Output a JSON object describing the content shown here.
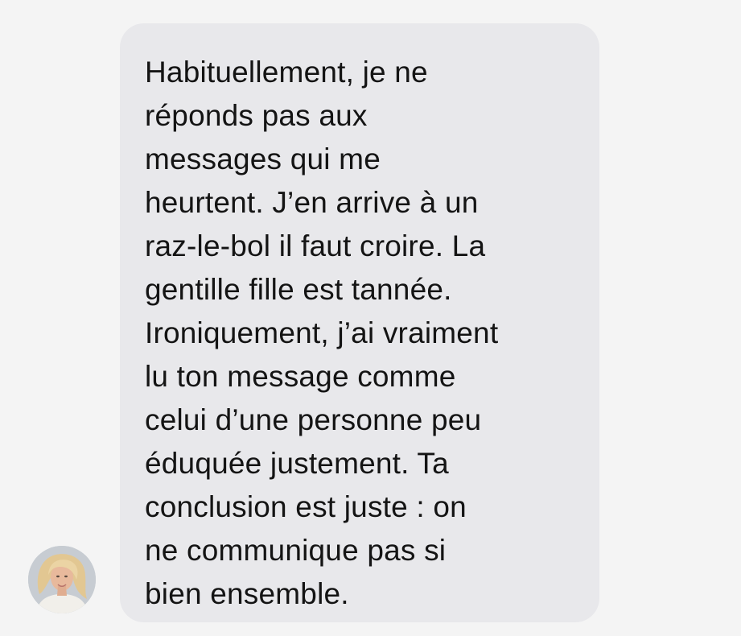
{
  "message": {
    "lines": [
      "Habituellement, je ne",
      "réponds pas aux",
      "messages qui me",
      "heurtent. J’en arrive à un",
      "raz-le-bol il faut croire. La",
      "gentille fille est tannée.",
      "Ironiquement, j’ai vraiment",
      "lu ton message comme",
      "celui d’une personne peu",
      "éduquée justement. Ta",
      "conclusion est juste : on",
      "ne communique pas si",
      "bien ensemble."
    ]
  },
  "sender": {
    "avatar_icon": "avatar-photo"
  },
  "colors": {
    "background": "#f4f4f4",
    "bubble": "#e8e8eb",
    "text": "#141414"
  }
}
